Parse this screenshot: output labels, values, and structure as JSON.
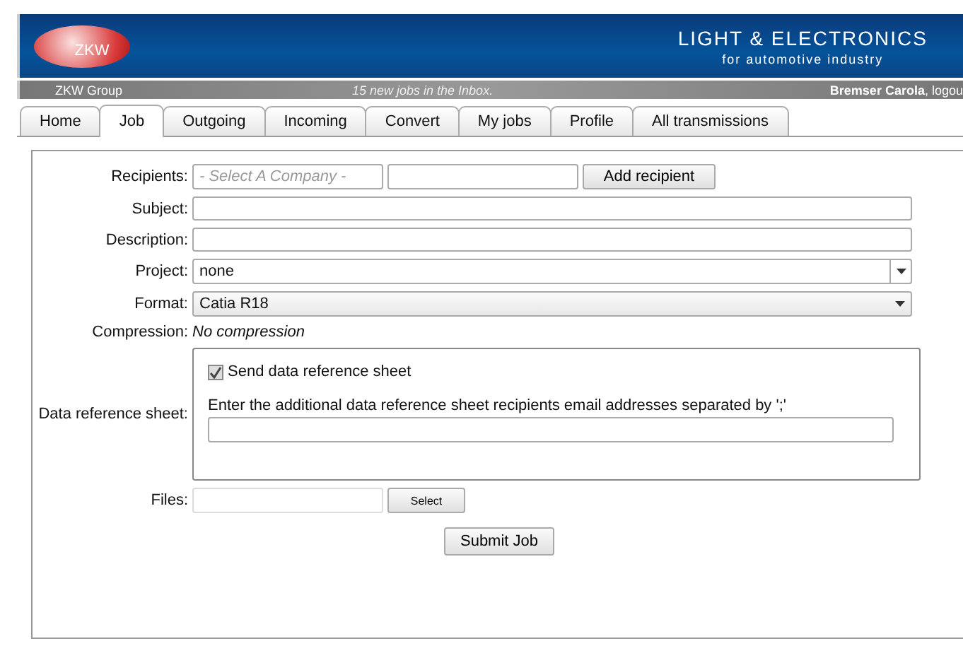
{
  "header": {
    "logo": "ZKW",
    "brand": "LIGHT & ELECTRONICS",
    "tagline": "for automotive industry"
  },
  "info_bar": {
    "group": "ZKW Group",
    "message": "15 new jobs in the Inbox.",
    "user": "Bremser Carola",
    "logout": ", logou"
  },
  "tabs": [
    {
      "label": "Home",
      "selected": false
    },
    {
      "label": "Job",
      "selected": true
    },
    {
      "label": "Outgoing",
      "selected": false
    },
    {
      "label": "Incoming",
      "selected": false
    },
    {
      "label": "Convert",
      "selected": false
    },
    {
      "label": "My jobs",
      "selected": false
    },
    {
      "label": "Profile",
      "selected": false
    },
    {
      "label": "All transmissions",
      "selected": false
    }
  ],
  "form": {
    "recipients": {
      "label": "Recipients:",
      "company_placeholder": "- Select A Company -",
      "button": "Add recipient"
    },
    "subject": {
      "label": "Subject:"
    },
    "description": {
      "label": "Description:"
    },
    "project": {
      "label": "Project:",
      "value": "none"
    },
    "format": {
      "label": "Format:",
      "value": "Catia R18"
    },
    "compression": {
      "label": "Compression:",
      "value": "No compression"
    },
    "data_reference_sheet": {
      "label": "Data reference sheet:",
      "checkbox_label": "Send data reference sheet",
      "checked": true,
      "email_label": "Enter the additional data reference sheet recipients email addresses separated by ';'"
    },
    "files": {
      "label": "Files:",
      "button": "Select"
    },
    "submit": "Submit Job"
  }
}
